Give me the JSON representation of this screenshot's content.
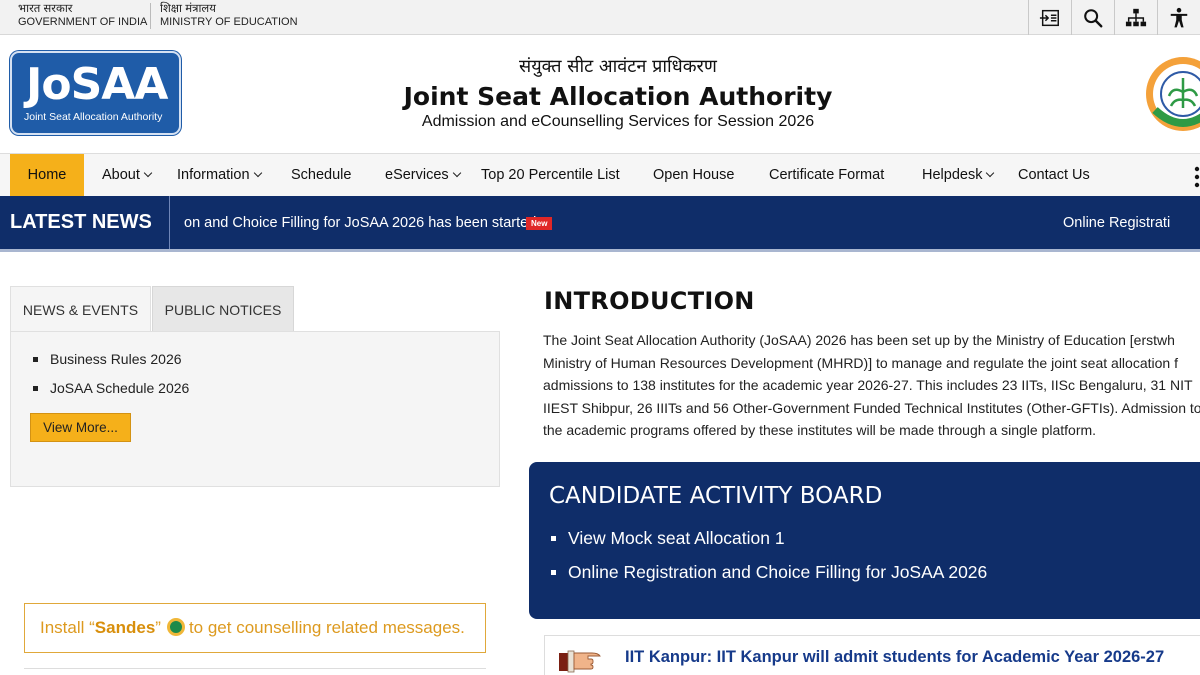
{
  "gov": {
    "india_hindi": "भारत सरकार",
    "india_en": "GOVERNMENT OF INDIA",
    "ministry_hindi": "शिक्षा मंत्रालय",
    "ministry_en": "MINISTRY OF EDUCATION",
    "tools": [
      "skip-to-content-icon",
      "search-icon",
      "sitemap-icon",
      "accessibility-icon"
    ]
  },
  "header": {
    "logo_text": "JoSAA",
    "logo_subtitle": "Joint Seat Allocation Authority",
    "hindi_title": "संयुक्त सीट आवंटन प्राधिकरण",
    "title": "Joint Seat Allocation Authority",
    "subtitle": "Admission and eCounselling Services for Session 2026",
    "emblem_icon": "emblem-icon"
  },
  "nav": {
    "items": [
      {
        "label": "Home",
        "active": true
      },
      {
        "label": "About",
        "dropdown": true
      },
      {
        "label": "Information",
        "dropdown": true
      },
      {
        "label": "Schedule"
      },
      {
        "label": "eServices",
        "dropdown": true
      },
      {
        "label": "Top 20 Percentile List"
      },
      {
        "label": "Open House"
      },
      {
        "label": "Certificate Format"
      },
      {
        "label": "Helpdesk",
        "dropdown": true
      },
      {
        "label": "Contact Us"
      }
    ]
  },
  "news": {
    "label": "LATEST NEWS",
    "ticker_1": "on and Choice Filling for JoSAA 2026 has been started.",
    "new_badge": "New",
    "ticker_2": "Online Registrati"
  },
  "tabs": {
    "news_events": "NEWS & EVENTS",
    "public_notices": "PUBLIC NOTICES"
  },
  "news_events": {
    "items": [
      "Business Rules 2026",
      "JoSAA Schedule 2026"
    ],
    "view_more": "View More..."
  },
  "sandes": {
    "prefix": "Install “",
    "app": "Sandes",
    "suffix_quote": "”",
    "tail": "to get counselling related messages."
  },
  "intro": {
    "title": "INTRODUCTION",
    "lines": [
      "The Joint Seat Allocation Authority (JoSAA) 2026 has been set up by the Ministry of Education [erstwh",
      "Ministry of Human Resources Development (MHRD)] to manage and regulate the joint seat allocation f",
      "admissions to 138 institutes for the academic year 2026-27. This includes 23 IITs, IISc Bengaluru, 31 NIT",
      "IIEST Shibpur, 26 IIITs and 56 Other-Government Funded Technical Institutes (Other-GFTIs). Admission to",
      "the academic programs offered by these institutes will be made through a single platform."
    ]
  },
  "cab": {
    "title": "CANDIDATE ACTIVITY BOARD",
    "items": [
      "View Mock seat Allocation 1",
      "Online Registration and Choice Filling for JoSAA 2026"
    ]
  },
  "announcement": {
    "text": "IIT Kanpur: IIT Kanpur will admit students for Academic Year 2026-27"
  },
  "colors": {
    "navy": "#0f2d69",
    "accent": "#f5b01a",
    "logo_blue": "#1f5ca8",
    "link": "#163a8a"
  }
}
